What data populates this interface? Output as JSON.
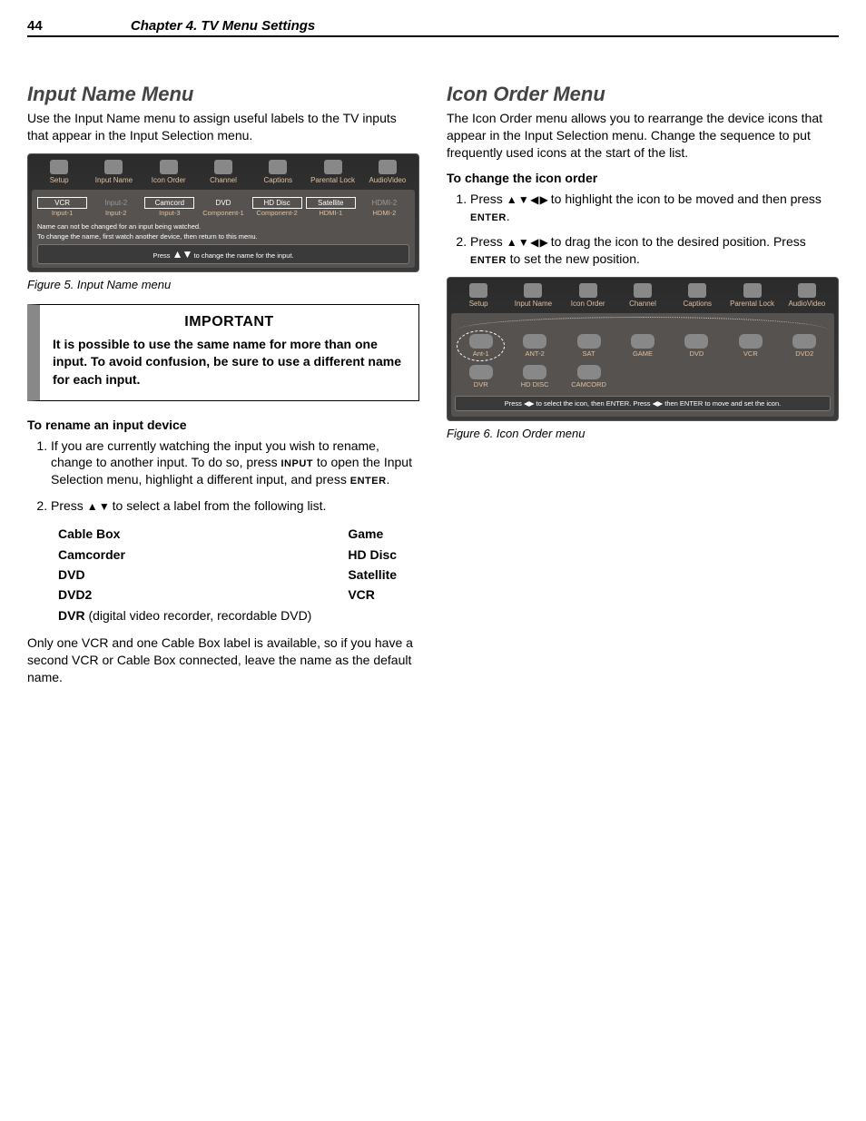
{
  "page": {
    "number": "44",
    "chapter": "Chapter 4. TV Menu Settings"
  },
  "left": {
    "heading": "Input Name Menu",
    "intro": "Use the Input Name menu to assign useful labels to the TV inputs that appear in the Input Selection menu.",
    "fig_caption": "Figure 5.  Input Name menu",
    "important_title": "IMPORTANT",
    "important_body": "It is possible to use the same name for more than one input. To avoid confusion, be sure to use a different name for each input.",
    "rename_heading": "To rename an input device",
    "step1a": "If you are currently watching the input you wish to rename, change to another input.  To do so, press ",
    "step1b": " to open the Input Selection menu, highlight a different input, and press ",
    "step1c": ".",
    "kbd_input": "INPUT",
    "kbd_enter": "ENTER",
    "step2a": "Press  ",
    "step2b": "  to select a label from the following list.",
    "labels_colA": [
      "Cable Box",
      "Camcorder",
      "DVD",
      "DVD2"
    ],
    "labels_dvr": "DVR",
    "labels_dvr_note": " (digital video recorder, recordable DVD)",
    "labels_colB": [
      "Game",
      "HD Disc",
      "Satellite",
      "VCR"
    ],
    "note_after": "Only one VCR and one Cable Box label is available, so if you have a second VCR or Cable Box connected, leave the name as the default name."
  },
  "right": {
    "heading": "Icon Order Menu",
    "intro": "The Icon Order menu allows you to rearrange the device icons that appear in the Input Selection menu.  Change the sequence to put frequently used icons at the start of the list.",
    "change_heading": "To change the icon order",
    "step1a": "Press  ",
    "step1b": " to highlight the icon to be moved and then press ",
    "step1c": ".",
    "step2a": "Press ",
    "step2b": " to drag the icon to the desired position.  Press ",
    "step2c": " to set the new position.",
    "kbd_enter": "ENTER",
    "fig_caption": "Figure 6.  Icon Order menu"
  },
  "osd_tabs": [
    {
      "label": "Setup"
    },
    {
      "label": "Input Name"
    },
    {
      "label": "Icon Order"
    },
    {
      "label": "Channel"
    },
    {
      "label": "Captions"
    },
    {
      "label": "Parental Lock"
    },
    {
      "label": "AudioVideo"
    }
  ],
  "osd_inputname": {
    "cells": [
      {
        "name": "VCR",
        "sub": "Input-1",
        "boxed": true
      },
      {
        "name": "Input-2",
        "sub": "Input-2",
        "dim": true
      },
      {
        "name": "Camcord",
        "sub": "Input-3",
        "boxed": true
      },
      {
        "name": "DVD",
        "sub": "Component-1"
      },
      {
        "name": "HD Disc",
        "sub": "Component-2",
        "boxed": true
      },
      {
        "name": "Satellite",
        "sub": "HDMI-1",
        "boxed": true
      },
      {
        "name": "HDMI-2",
        "sub": "HDMI-2",
        "dim": true
      }
    ],
    "note1": "Name can not be changed for an input being watched.",
    "note2": "To change the name, first watch another device, then return to this menu.",
    "status_a": "Press ",
    "status_b": " to change the name for the input."
  },
  "osd_iconorder": {
    "row1": [
      "Ant-1",
      "ANT-2",
      "SAT",
      "GAME",
      "DVD",
      "VCR",
      "DVD2"
    ],
    "row2": [
      "DVR",
      "HD DISC",
      "CAMCORD"
    ],
    "status": "Press ◀▶ to select the icon, then ENTER. Press ◀▶ then ENTER to move and set the icon."
  }
}
